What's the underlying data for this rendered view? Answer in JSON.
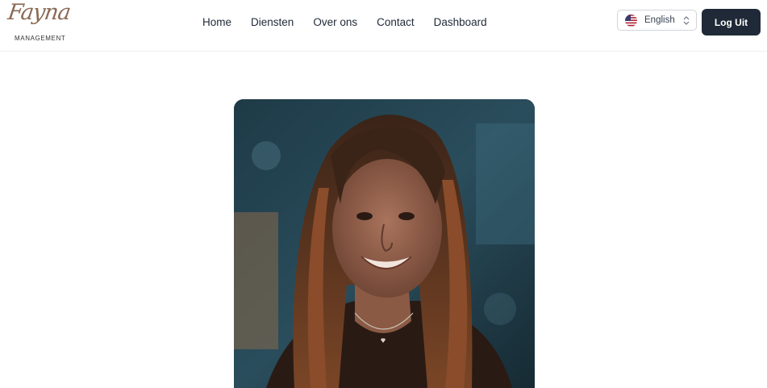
{
  "brand": {
    "script_text": "Fayna",
    "subtitle": "MANAGEMENT"
  },
  "nav": {
    "items": [
      {
        "label": "Home"
      },
      {
        "label": "Diensten"
      },
      {
        "label": "Over ons"
      },
      {
        "label": "Contact"
      },
      {
        "label": "Dashboard"
      }
    ]
  },
  "language": {
    "selected": "English",
    "flag_icon": "us-flag-icon"
  },
  "header": {
    "logout_label": "Log Uit"
  },
  "colors": {
    "primary_button": "#1f2937",
    "logo_brown": "#8a6a55",
    "border": "#eceef1"
  },
  "hero": {
    "image_subject": "portrait-photo"
  }
}
